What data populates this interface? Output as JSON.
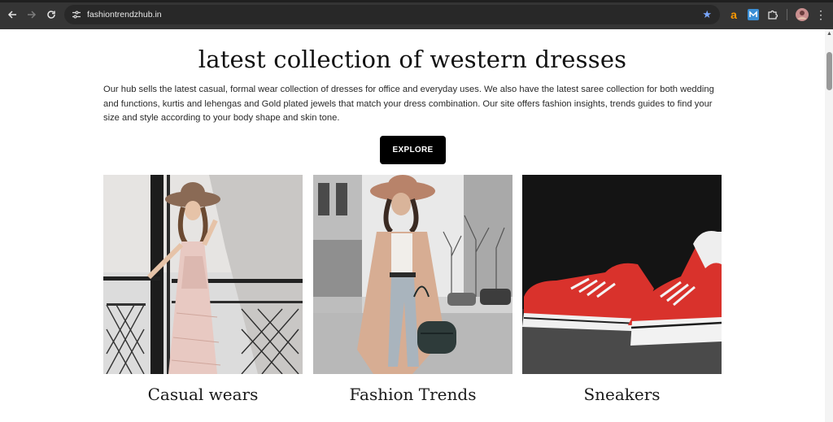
{
  "browser": {
    "url": "fashiontrendzhub.in",
    "extensions": [
      "amazon-icon",
      "m-extension-icon",
      "puzzle-icon"
    ],
    "icons": {
      "back": "arrow-left",
      "forward": "arrow-right",
      "reload": "reload",
      "bookmark": "star",
      "menu": "kebab"
    },
    "ext_amazon_label": "a"
  },
  "page": {
    "title": "latest collection of western dresses",
    "intro": "Our hub sells the latest casual, formal wear collection of dresses for office and everyday uses. We also have the latest saree collection for both wedding and functions, kurtis and lehengas and Gold plated jewels that match your dress combination. Our site offers fashion insights, trends guides to find your size and style according to your body shape and skin tone.",
    "cta_label": "EXPLORE",
    "categories": [
      {
        "title": "Casual wears",
        "image": "woman-in-hat-pink-dress"
      },
      {
        "title": "Fashion Trends",
        "image": "woman-in-hat-trench-coat"
      },
      {
        "title": "Sneakers",
        "image": "red-sneakers"
      }
    ]
  },
  "colors": {
    "chrome_bg": "#353535",
    "omnibox_bg": "#282828",
    "button_bg": "#000000",
    "button_text": "#ffffff",
    "sneaker_red": "#d9322c"
  }
}
